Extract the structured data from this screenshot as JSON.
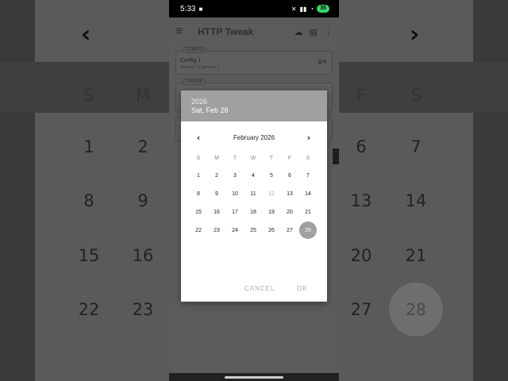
{
  "status": {
    "time": "5:33",
    "battery": "35"
  },
  "app": {
    "title": "HTTP Tweak",
    "config_legend": "CONFIG",
    "config_name": "Config 1",
    "config_sub": "Tweaks: 1 | Servers: 1",
    "tweak_legend": "TWEAK"
  },
  "dialog": {
    "year": "2026",
    "selected_date": "Sat, Feb 28",
    "month_title": "February 2026",
    "weekdays": [
      "S",
      "M",
      "T",
      "W",
      "T",
      "F",
      "S"
    ],
    "days": [
      [
        "1",
        "2",
        "3",
        "4",
        "5",
        "6",
        "7"
      ],
      [
        "8",
        "9",
        "10",
        "11",
        "12",
        "13",
        "14"
      ],
      [
        "15",
        "16",
        "17",
        "18",
        "19",
        "20",
        "21"
      ],
      [
        "22",
        "23",
        "24",
        "25",
        "26",
        "27",
        "28"
      ]
    ],
    "cancel_label": "CANCEL",
    "ok_label": "OK"
  },
  "background": {
    "headers_left": [
      "S",
      "M"
    ],
    "headers_right": [
      "F",
      "S"
    ],
    "rows_left": [
      [
        "1",
        "2"
      ],
      [
        "8",
        "9"
      ],
      [
        "15",
        "16"
      ],
      [
        "22",
        "23"
      ]
    ],
    "rows_right": [
      [
        "6",
        "7"
      ],
      [
        "13",
        "14"
      ],
      [
        "20",
        "21"
      ],
      [
        "27",
        "28"
      ]
    ]
  },
  "colors": {
    "header": "#a0a0a0",
    "selected": "#a0a0a0",
    "battery": "#3bd46b"
  }
}
